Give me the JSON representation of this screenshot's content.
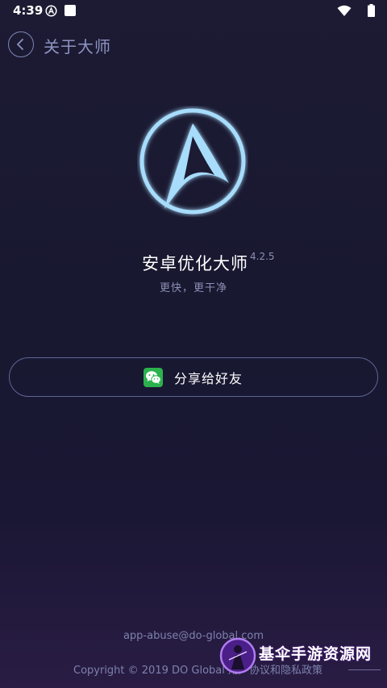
{
  "status_bar": {
    "time": "4:39"
  },
  "header": {
    "title": "关于大师"
  },
  "app": {
    "name": "安卓优化大师",
    "version": "4.2.5",
    "slogan": "更快，更干净"
  },
  "share": {
    "label": "分享给好友",
    "icon": "wechat-icon"
  },
  "footer": {
    "email": "app-abuse@do-global.com",
    "copyright": "Copyright © 2019 DO Global",
    "agreement_link": "用户协议和隐私政策"
  },
  "watermark": {
    "text": "基伞手游资源网"
  },
  "colors": {
    "background": "#1c1b33",
    "accent": "#8ecdf7",
    "muted_text": "#8b8fb3",
    "wechat": "#2bb24c"
  }
}
